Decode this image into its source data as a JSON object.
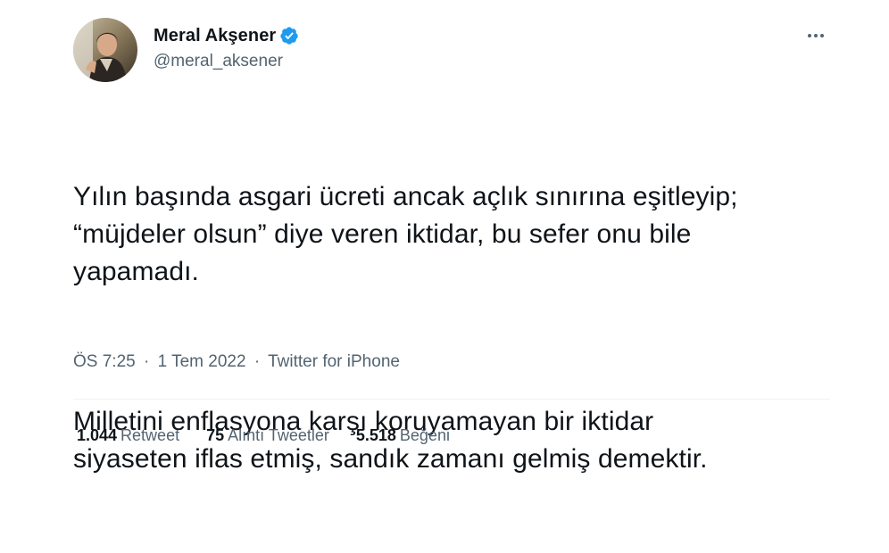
{
  "author": {
    "display_name": "Meral Akşener",
    "handle": "@meral_aksener",
    "verified": true,
    "avatar_icon": "profile-photo"
  },
  "tweet": {
    "paragraphs": [
      "Yılın başında asgari ücreti ancak açlık sınırına eşitleyip;\n“müjdeler olsun” diye veren iktidar, bu sefer onu bile\nyapamadı.",
      "Milletini enflasyona karşı koruyamayan bir iktidar\nsiyaseten iflas etmiş, sandık zamanı gelmiş demektir."
    ]
  },
  "meta": {
    "time": "ÖS 7:25",
    "separator": "·",
    "date": "1 Tem 2022",
    "source": "Twitter for iPhone"
  },
  "stats": {
    "retweets": {
      "count": "1.044",
      "label": "Retweet"
    },
    "quotes": {
      "count": "75",
      "label": "Alıntı Tweetler"
    },
    "likes": {
      "count": "5.518",
      "label": "Beğeni"
    }
  },
  "menu": {
    "icon": "more-horizontal-icon"
  },
  "colors": {
    "text": "#0f1419",
    "secondary": "#536471",
    "verified": "#1d9bf0",
    "divider": "#eff3f4"
  }
}
